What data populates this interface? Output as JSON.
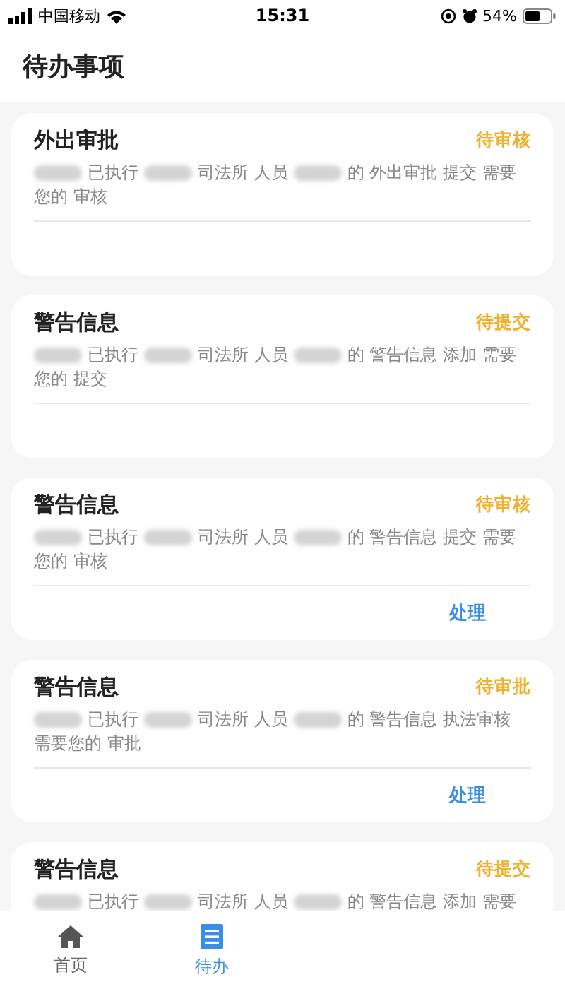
{
  "status_bar": {
    "carrier": "中国移动",
    "time": "15:31",
    "battery": "54%"
  },
  "header": {
    "title": "待办事项"
  },
  "cards": [
    {
      "title": "外出审批",
      "status": "待审核",
      "description": [
        {
          "kind": "blur"
        },
        {
          "kind": "text",
          "text": "已执行"
        },
        {
          "kind": "blur"
        },
        {
          "kind": "text",
          "text": "司法所 人员"
        },
        {
          "kind": "blur"
        },
        {
          "kind": "text",
          "text": "的 外出审批 提交 需要"
        },
        {
          "kind": "text",
          "text": "您的 审核"
        }
      ]
    },
    {
      "title": "警告信息",
      "status": "待提交",
      "description": [
        {
          "kind": "blur"
        },
        {
          "kind": "text",
          "text": "已执行"
        },
        {
          "kind": "blur"
        },
        {
          "kind": "text",
          "text": "司法所 人员"
        },
        {
          "kind": "blur"
        },
        {
          "kind": "text",
          "text": "的 警告信息 添加 需要"
        },
        {
          "kind": "text",
          "text": "您的 提交"
        }
      ]
    },
    {
      "title": "警告信息",
      "status": "待审核",
      "description": [
        {
          "kind": "blur"
        },
        {
          "kind": "text",
          "text": "已执行"
        },
        {
          "kind": "blur"
        },
        {
          "kind": "text",
          "text": "司法所 人员"
        },
        {
          "kind": "blur"
        },
        {
          "kind": "text",
          "text": "的 警告信息 提交 需要"
        },
        {
          "kind": "text",
          "text": "您的 审核"
        }
      ],
      "action": "处理"
    },
    {
      "title": "警告信息",
      "status": "待审批",
      "description": [
        {
          "kind": "blur"
        },
        {
          "kind": "text",
          "text": "已执行"
        },
        {
          "kind": "blur"
        },
        {
          "kind": "text",
          "text": "司法所 人员"
        },
        {
          "kind": "blur"
        },
        {
          "kind": "text",
          "text": "的 警告信息 执法审核"
        },
        {
          "kind": "text",
          "text": "需要您的 审批"
        }
      ],
      "action": "处理"
    },
    {
      "title": "警告信息",
      "status": "待提交",
      "description": [
        {
          "kind": "blur"
        },
        {
          "kind": "text",
          "text": "已执行"
        },
        {
          "kind": "blur"
        },
        {
          "kind": "text",
          "text": "司法所 人员"
        },
        {
          "kind": "blur"
        },
        {
          "kind": "text",
          "text": "的 警告信息 添加 需要"
        }
      ]
    }
  ],
  "tab_bar": [
    {
      "label": "首页",
      "kind": "home",
      "selected": false
    },
    {
      "label": "待办",
      "kind": "list",
      "selected": true
    }
  ]
}
